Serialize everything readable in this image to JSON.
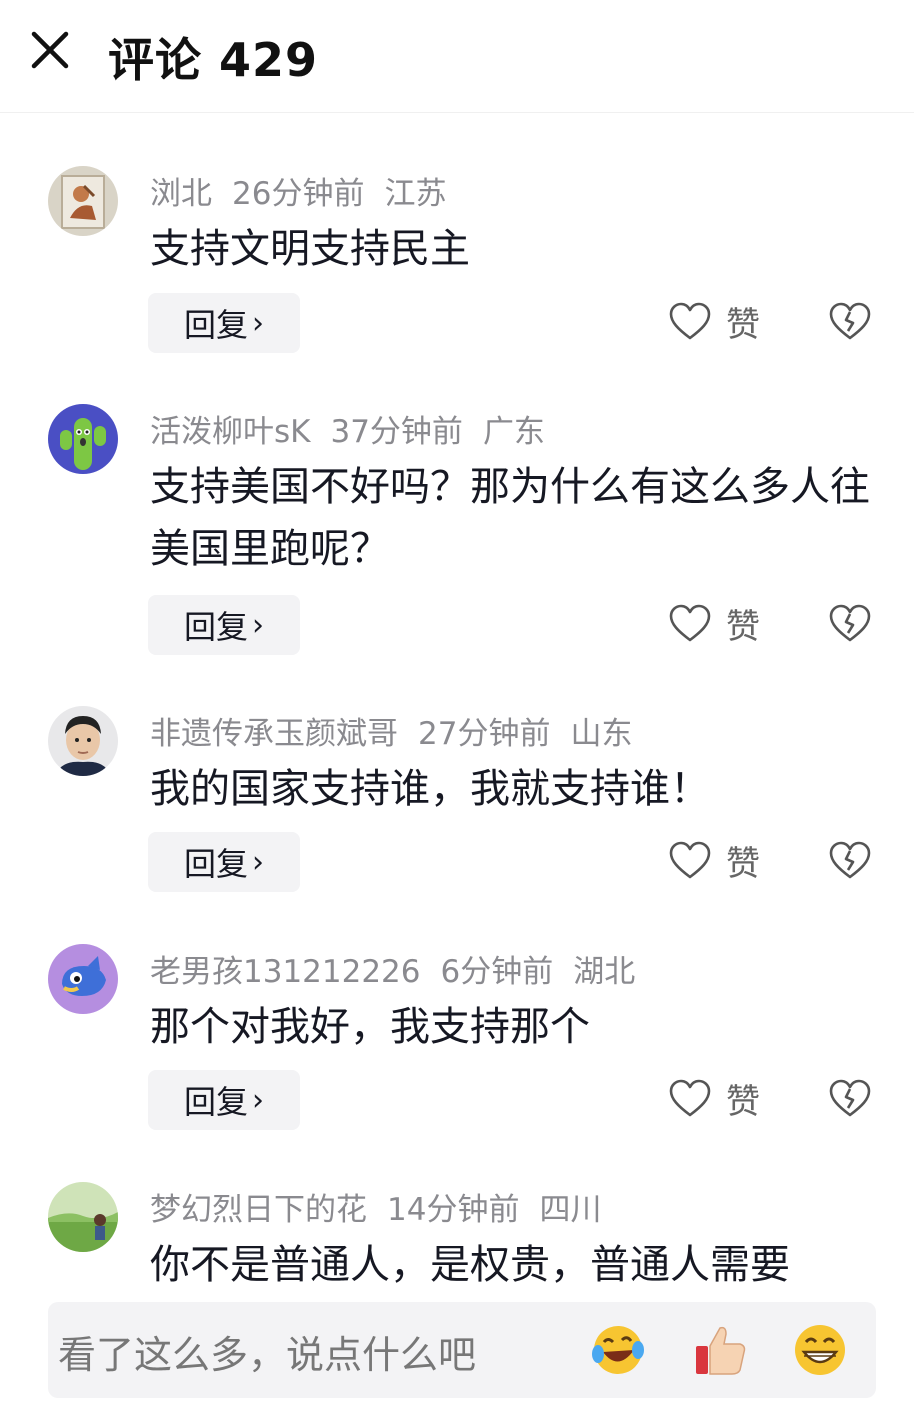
{
  "header": {
    "title": "评论 429"
  },
  "comments": [
    {
      "user": "浏北",
      "time": "26分钟前",
      "location": "江苏",
      "text": "支持文明支持民主",
      "reply_label": "回复",
      "like_label": "赞"
    },
    {
      "user": "活泼柳叶sK",
      "time": "37分钟前",
      "location": "广东",
      "text": "支持美国不好吗？那为什么有这么多人往美国里跑呢？",
      "reply_label": "回复",
      "like_label": "赞"
    },
    {
      "user": "非遗传承玉颜斌哥",
      "time": "27分钟前",
      "location": "山东",
      "text": "我的国家支持谁，我就支持谁！",
      "reply_label": "回复",
      "like_label": "赞"
    },
    {
      "user": "老男孩131212226",
      "time": "6分钟前",
      "location": "湖北",
      "text": "那个对我好，我支持那个",
      "reply_label": "回复",
      "like_label": "赞"
    },
    {
      "user": "梦幻烈日下的花",
      "time": "14分钟前",
      "location": "四川",
      "text": "你不是普通人，是权贵，普通人需要"
    }
  ],
  "input": {
    "placeholder": "看了这么多，说点什么吧"
  },
  "icons": {
    "close": "close-icon",
    "heart": "heart-icon",
    "broken_heart": "broken-heart-icon",
    "chevron": "chevron-right-icon",
    "emoji_laugh": "laugh-cry-emoji-icon",
    "emoji_thumb": "thumbs-up-emoji-icon",
    "emoji_grin": "grin-emoji-icon"
  },
  "colors": {
    "text": "#161823",
    "meta": "#8a8a8f",
    "button_bg": "#f3f3f5"
  }
}
